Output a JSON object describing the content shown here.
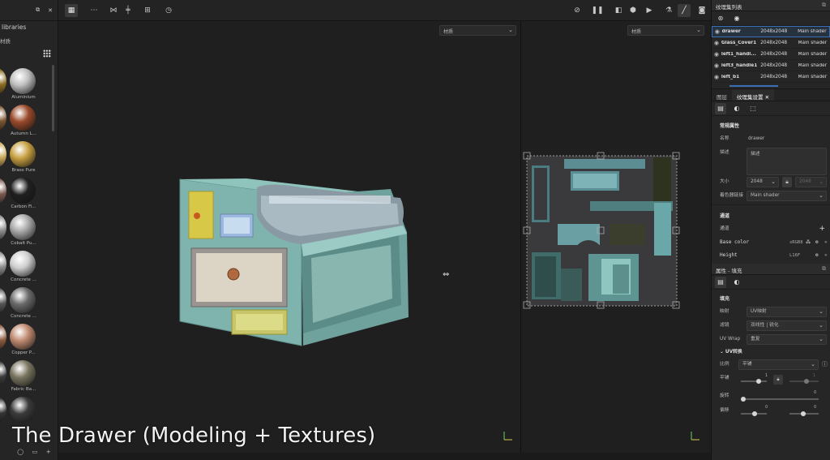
{
  "shelf": {
    "title": "libraries",
    "subtitle": "材质",
    "materials": [
      {
        "label": "",
        "color": "#8a6a20"
      },
      {
        "label": "Aluminium",
        "color": "#bfbfbf"
      },
      {
        "label": "",
        "color": "#7a5530"
      },
      {
        "label": "Autumn L...",
        "color": "#9a4a2a"
      },
      {
        "label": "",
        "color": "#c9a85a"
      },
      {
        "label": "Brass Pure",
        "color": "#c7a040"
      },
      {
        "label": "",
        "color": "#7a5850"
      },
      {
        "label": "Carbon Fi...",
        "color": "#202020"
      },
      {
        "label": "",
        "color": "#8c8c8c"
      },
      {
        "label": "Cobalt Pu...",
        "color": "#a9a9a9"
      },
      {
        "label": "",
        "color": "#8c8c8c"
      },
      {
        "label": "Concrete ...",
        "color": "#cfcfcf"
      },
      {
        "label": "",
        "color": "#555"
      },
      {
        "label": "Concrete ...",
        "color": "#6a6a6a"
      },
      {
        "label": "",
        "color": "#8c5a40"
      },
      {
        "label": "Copper P...",
        "color": "#c08a70"
      },
      {
        "label": "",
        "color": "#3a3a3a"
      },
      {
        "label": "Fabric Ba...",
        "color": "#7a7560"
      },
      {
        "label": "",
        "color": "#333"
      },
      {
        "label": "",
        "color": "#3a3a3a"
      }
    ]
  },
  "viewports": {
    "dropdown_3d": "材质",
    "dropdown_2d": "材质"
  },
  "right": {
    "texture_set_list_title": "纹理集列表",
    "texture_sets": [
      {
        "name": "drawer",
        "res": "2048x2048",
        "shader": "Main shader",
        "selected": true
      },
      {
        "name": "Glass_Cover1",
        "res": "2048x2048",
        "shader": "Main shader",
        "selected": false
      },
      {
        "name": "left1_handl...",
        "res": "2048x2048",
        "shader": "Main shader",
        "selected": false
      },
      {
        "name": "left3_handle1",
        "res": "2048x2048",
        "shader": "Main shader",
        "selected": false
      },
      {
        "name": "left_b1",
        "res": "2048x2048",
        "shader": "Main shader",
        "selected": false
      }
    ],
    "tabs": [
      "图层",
      "纹理集设置"
    ],
    "settings": {
      "section": "常规属性",
      "name_label": "名称",
      "name_value": "drawer",
      "desc_label": "描述",
      "desc_placeholder": "描述",
      "size_label": "大小",
      "size_value": "2048",
      "size_value2": "2048",
      "shader_label": "着色器链接",
      "shader_value": "Main shader"
    },
    "channels": {
      "section": "通道",
      "label": "通道",
      "items": [
        {
          "name": "Base color",
          "format": "sRGB8"
        },
        {
          "name": "Height",
          "format": "L16F"
        }
      ]
    },
    "properties": {
      "title": "属性 - 填充",
      "section": "填充",
      "mapping_label": "映射",
      "mapping_value": "UV映射",
      "filter_label": "滤镜",
      "filter_value": "双线性 | 锐化",
      "uvwrap_label": "UV Wrap",
      "uvwrap_value": "重复",
      "uvtransform_label": "UV转换",
      "scale_label": "比例",
      "scale_value": "平铺",
      "tile_label": "平铺",
      "tile_value": "1",
      "tile_value2": "1",
      "rotate_label": "旋转",
      "rotate_value": "0",
      "offset_label": "偏移",
      "offset_value": "0",
      "offset_value2": "0"
    }
  },
  "caption": "The Drawer (Modeling + Textures)"
}
